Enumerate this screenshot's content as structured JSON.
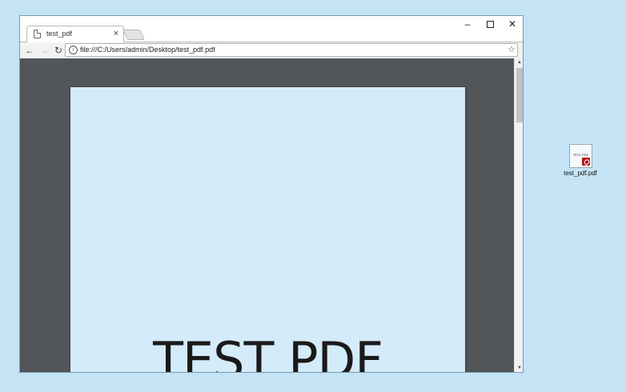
{
  "window": {
    "tab_title": "test_pdf",
    "tab_close": "×",
    "controls": {
      "minimize": "–",
      "close": "✕"
    }
  },
  "toolbar": {
    "back": "←",
    "forward": "→",
    "reload": "↻",
    "info": "i",
    "url": "file:///C:/Users/admin/Desktop/test_pdf.pdf",
    "bookmark": "☆"
  },
  "pdf": {
    "page_text": "TEST PDF"
  },
  "scrollbar": {
    "up": "▲",
    "down": "▼"
  },
  "desktop": {
    "icon_label": "test_pdf.pdf",
    "thumb_text": "TEST PDF"
  },
  "colors": {
    "desktop_bg": "#c4e4f5",
    "viewer_bg": "#525659",
    "page_bg": "#d4ebf9",
    "acrobat_red": "#b8121b"
  }
}
